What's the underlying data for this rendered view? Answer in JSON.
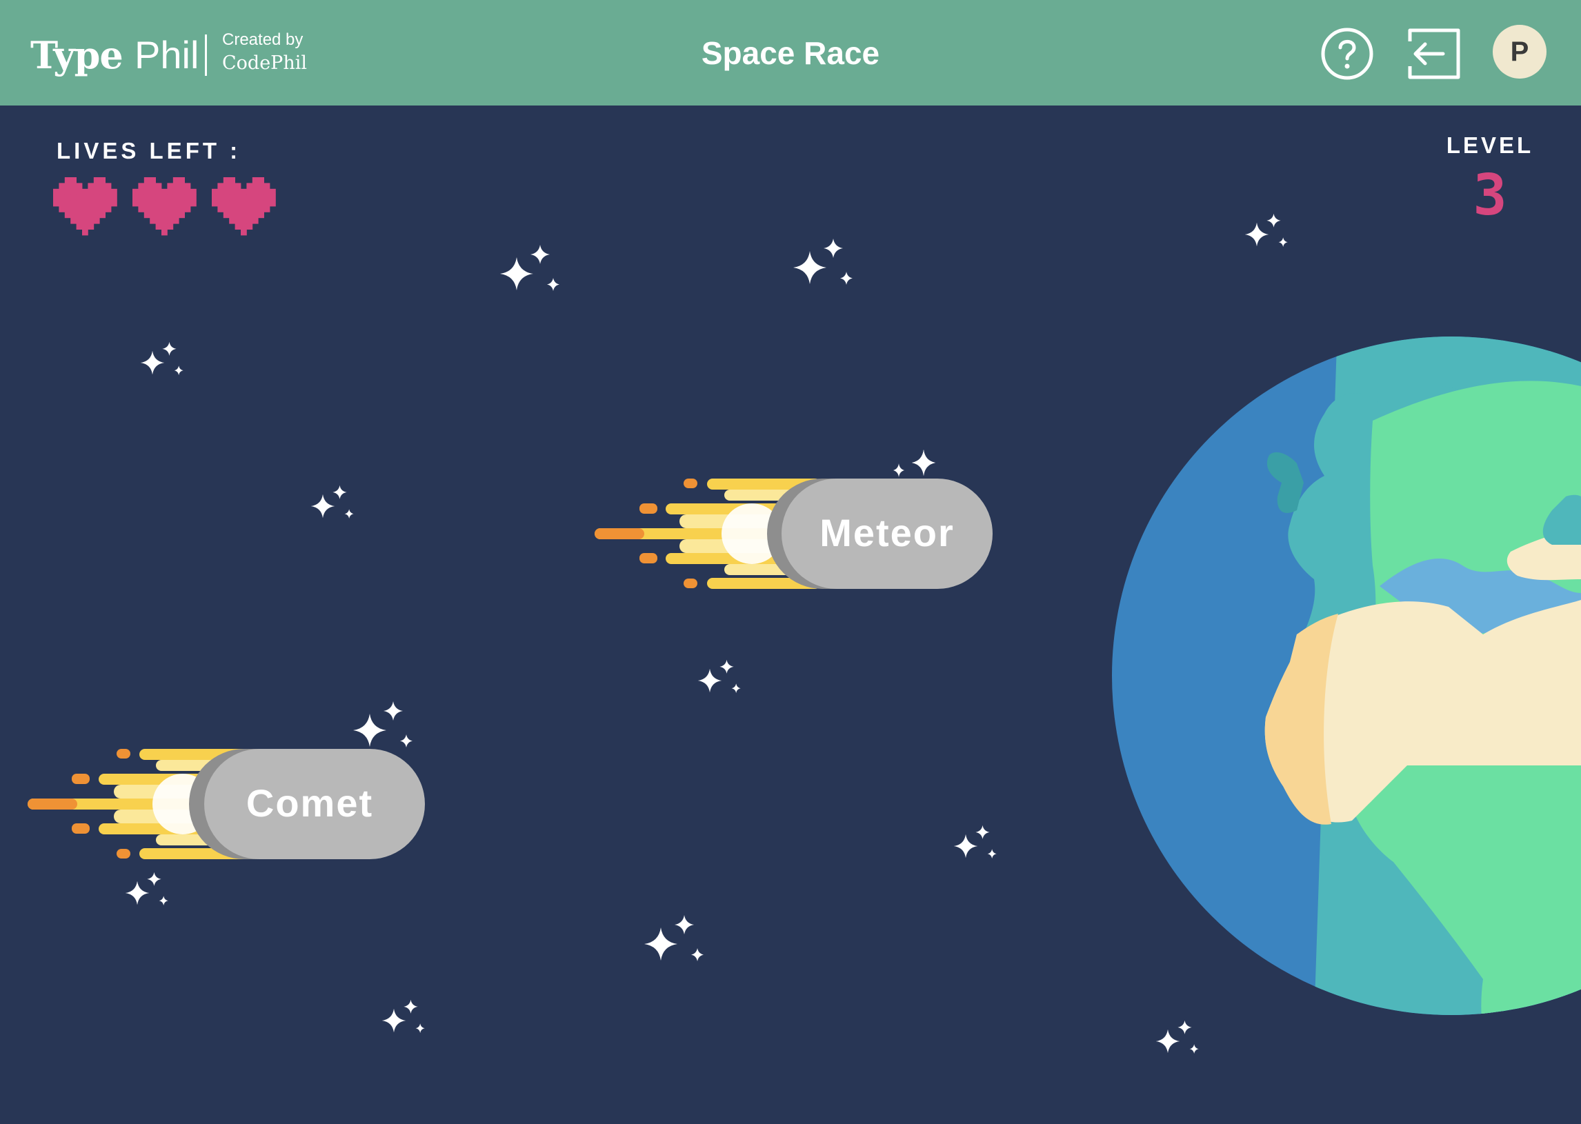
{
  "header": {
    "logo_type": "Type",
    "logo_phil": "Phil",
    "created_by": "Created by",
    "creator": "CodePhil",
    "title": "Space Race",
    "avatar_initial": "P",
    "help_icon": "question-circle-icon",
    "exit_icon": "exit-arrow-icon"
  },
  "hud": {
    "lives_label": "LIVES LEFT :",
    "lives_remaining": 3,
    "level_label": "LEVEL",
    "level_value": "3"
  },
  "words": [
    {
      "text": "Meteor"
    },
    {
      "text": "Comet"
    }
  ],
  "colors": {
    "header_bg": "#6aac93",
    "space_bg": "#283655",
    "heart": "#d6467e",
    "level_number": "#d6467e",
    "word_pill": "#b8b8b8",
    "flame_yellow": "#f8d14e",
    "flame_orange": "#ef9235",
    "ocean": "#3b84c0",
    "land_green": "#6be0a2",
    "land_teal": "#4fb7bb",
    "desert": "#f8ebc8"
  }
}
